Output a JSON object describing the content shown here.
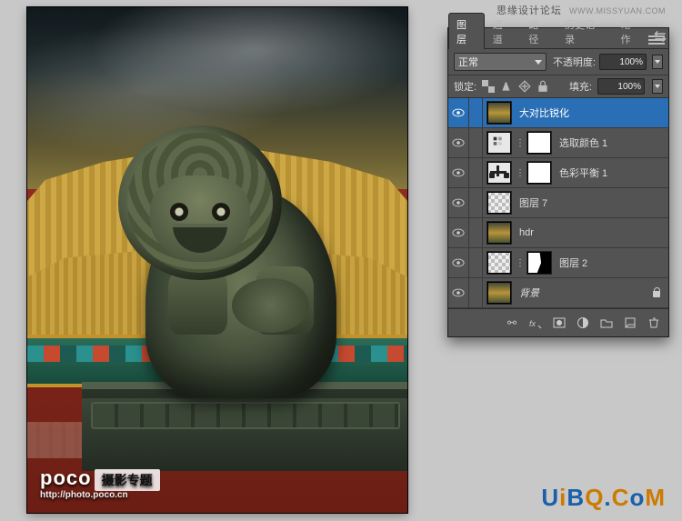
{
  "header": {
    "forum_name": "思缘设计论坛",
    "forum_site": "WWW.MISSYUAN.COM"
  },
  "artwork": {
    "poco_logo_text": "poco",
    "poco_tag": "摄影专题",
    "poco_url": "http://photo.poco.cn"
  },
  "brand": {
    "u": "U",
    "i": "i",
    "b": "B",
    "q": "Q",
    "dot": ".",
    "c": "C",
    "o": "o",
    "m": "M"
  },
  "panel": {
    "tabs": {
      "layers": "图层",
      "channels": "通道",
      "paths": "路径",
      "history": "历史记录",
      "actions": "动作"
    },
    "options": {
      "blend_mode": "正常",
      "opacity_label": "不透明度:",
      "opacity_value": "100%",
      "lock_label": "锁定:",
      "fill_label": "填充:",
      "fill_value": "100%"
    },
    "layers": [
      {
        "name": "大对比锐化",
        "thumb": "photo",
        "selected": true
      },
      {
        "name": "选取颜色 1",
        "thumb": "adjust",
        "mask": "white"
      },
      {
        "name": "色彩平衡 1",
        "thumb": "balance",
        "mask": "white"
      },
      {
        "name": "图层 7",
        "thumb": "checker"
      },
      {
        "name": "hdr",
        "thumb": "photo"
      },
      {
        "name": "图层 2",
        "thumb": "checker",
        "mask": "shape"
      },
      {
        "name": "背景",
        "thumb": "photo",
        "locked": true
      }
    ]
  }
}
